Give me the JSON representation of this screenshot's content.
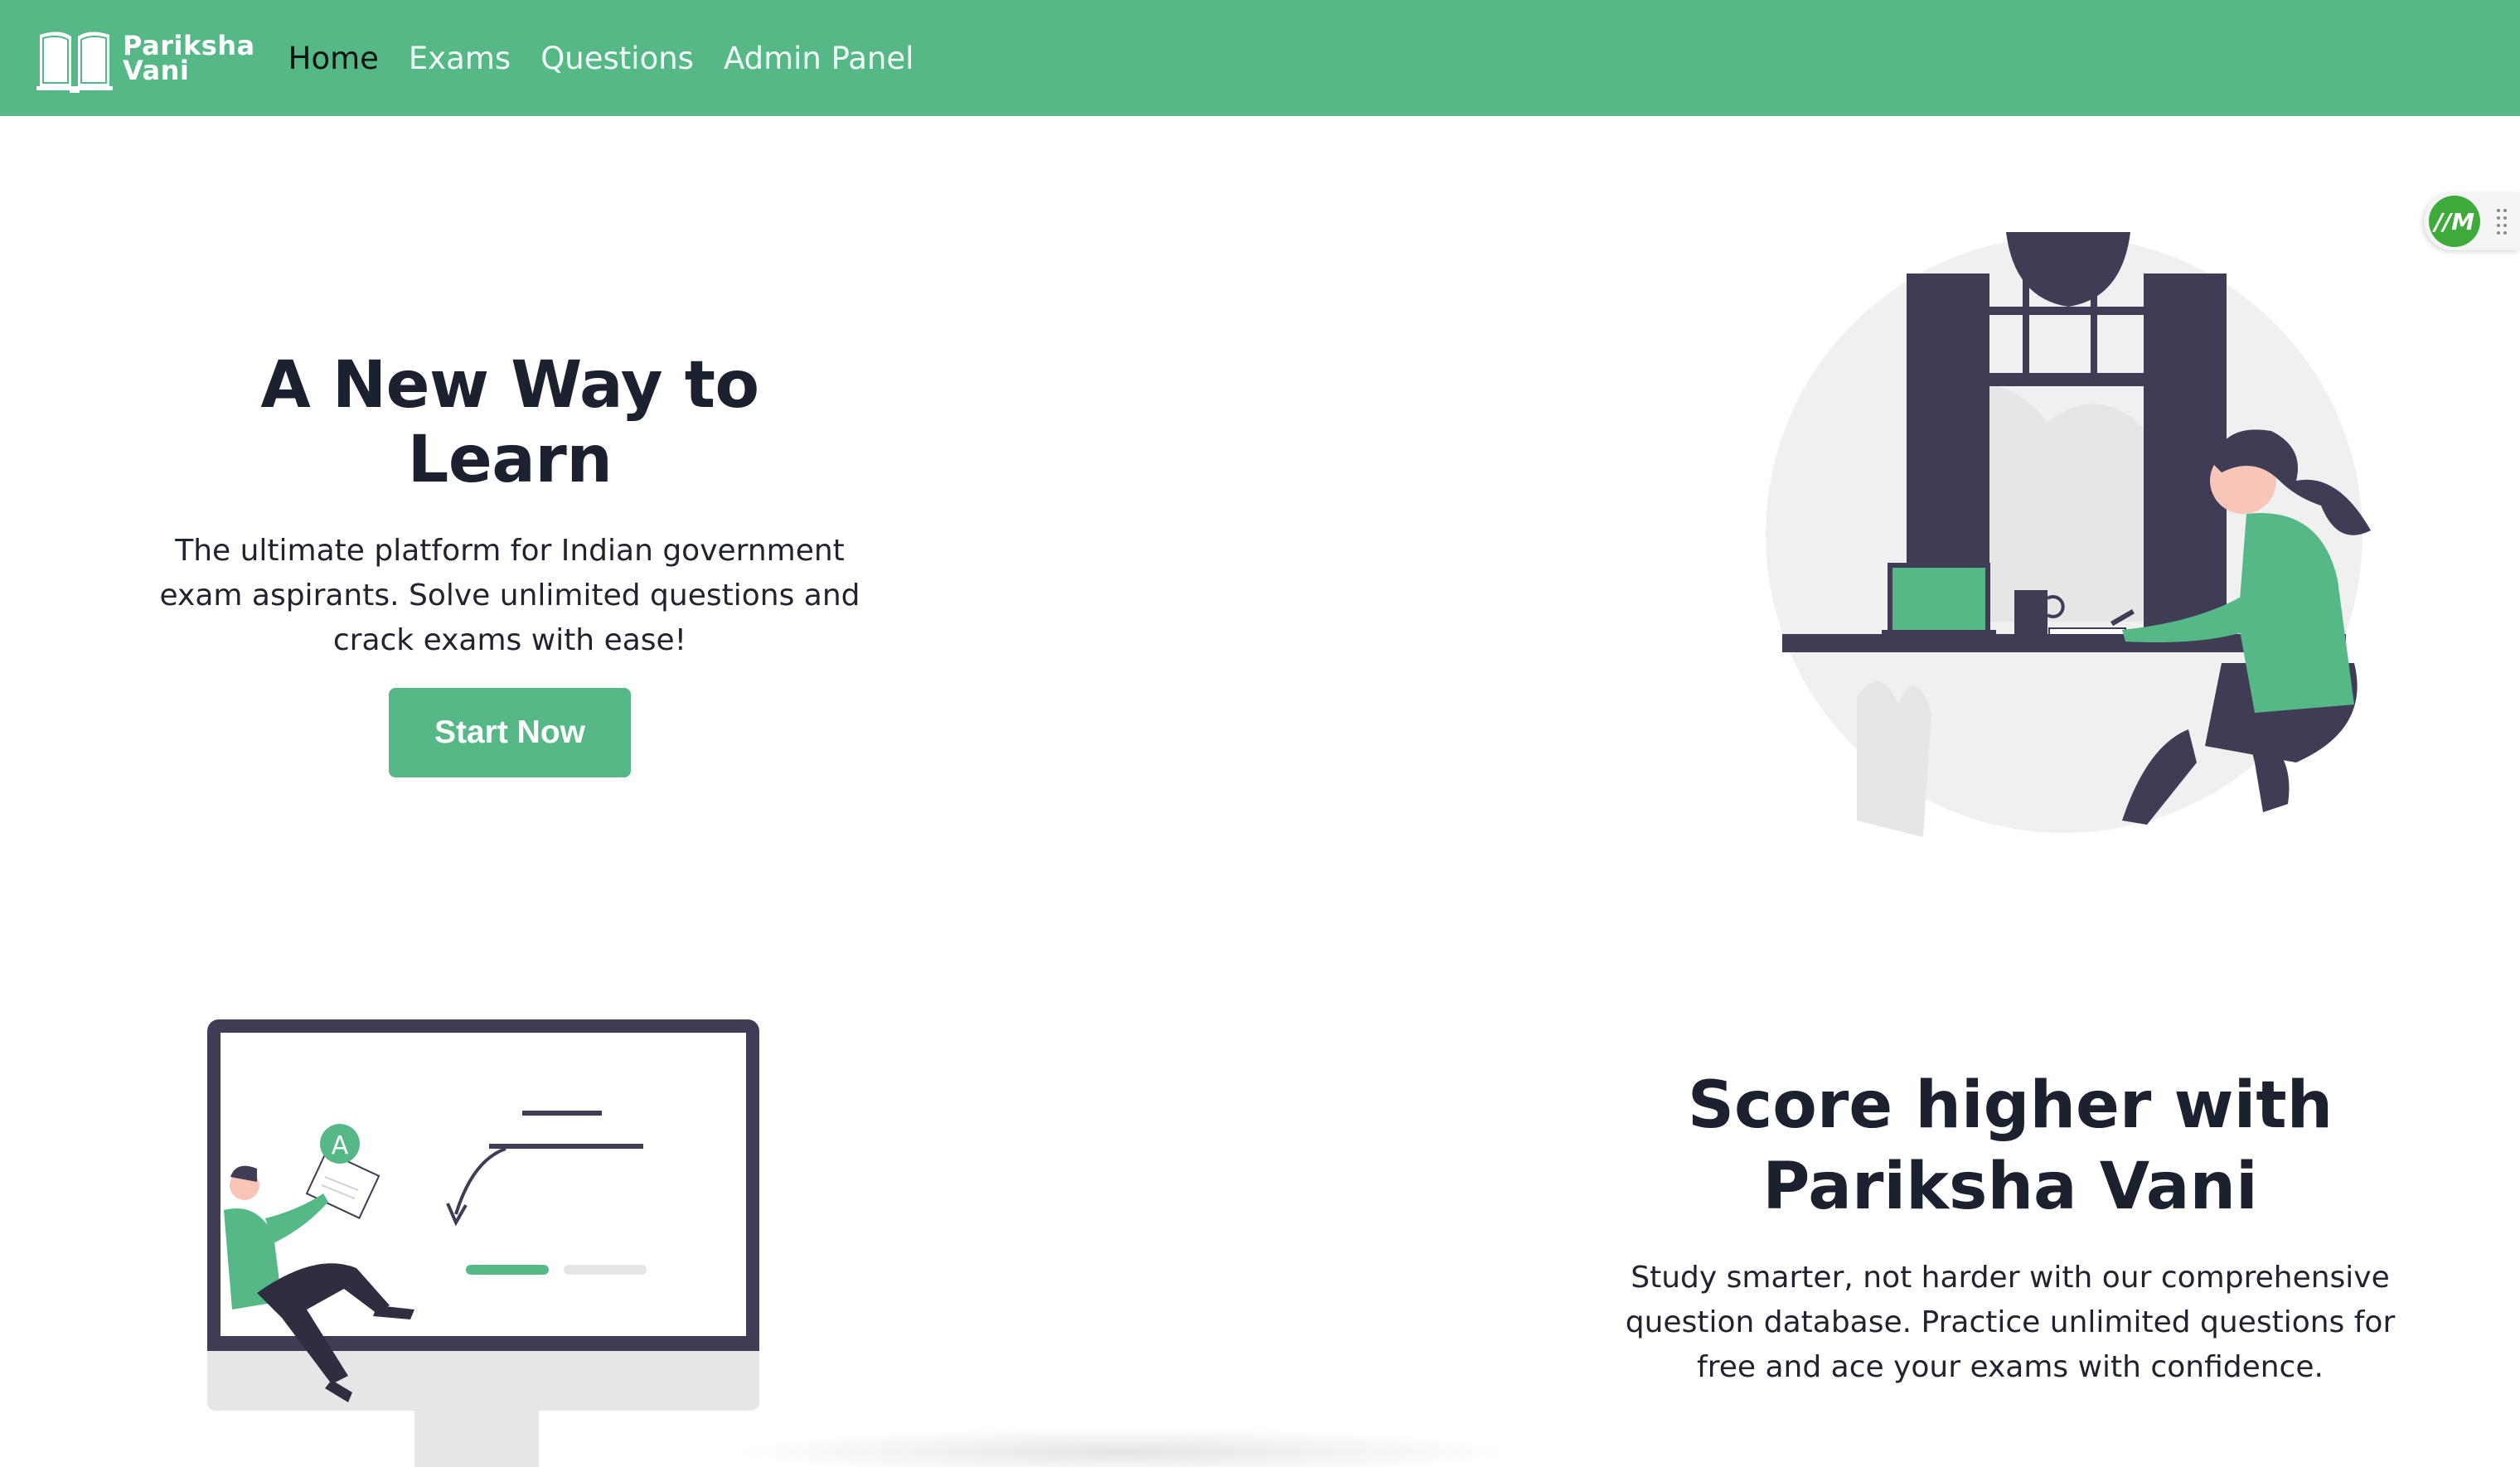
{
  "brand": {
    "name_line1": "Pariksha",
    "name_line2": "Vani"
  },
  "nav": {
    "items": [
      {
        "label": "Home",
        "active": true
      },
      {
        "label": "Exams",
        "active": false
      },
      {
        "label": "Questions",
        "active": false
      },
      {
        "label": "Admin Panel",
        "active": false
      }
    ]
  },
  "hero": {
    "title": "A New Way to Learn",
    "subtitle": "The ultimate platform for Indian government exam aspirants. Solve unlimited questions and crack exams with ease!",
    "cta_label": "Start Now"
  },
  "section2": {
    "title": "Score higher with Pariksha Vani",
    "subtitle": "Study smarter, not harder with our comprehensive question database. Practice unlimited questions for free and ace your exams with confidence."
  },
  "illustration2": {
    "badge_letter": "A"
  },
  "extension": {
    "badge": "//M"
  },
  "colors": {
    "accent": "#55b886",
    "dark": "#3f3d56",
    "light_gray": "#f0f0f0",
    "skin": "#f7c6b8"
  },
  "icons": [
    "open-book-icon",
    "grip-dots-icon"
  ]
}
